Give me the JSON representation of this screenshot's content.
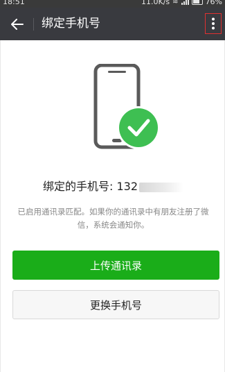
{
  "status_bar": {
    "time": "18:51",
    "network_speed": "11.0K/s",
    "battery": "76%"
  },
  "toolbar": {
    "title": "绑定手机号",
    "back_icon": "arrow-left-icon",
    "more_icon": "more-vertical-icon"
  },
  "main": {
    "phone_label": "绑定的手机号: ",
    "phone_visible": "132",
    "description": "已启用通讯录匹配。如果你的通讯录中有朋友注册了微信，系统会通知你。",
    "upload_button": "上传通讯录",
    "change_button": "更换手机号"
  },
  "colors": {
    "accent": "#1aad19",
    "toolbar_bg": "#393a3f",
    "highlight_box": "#e03131"
  }
}
